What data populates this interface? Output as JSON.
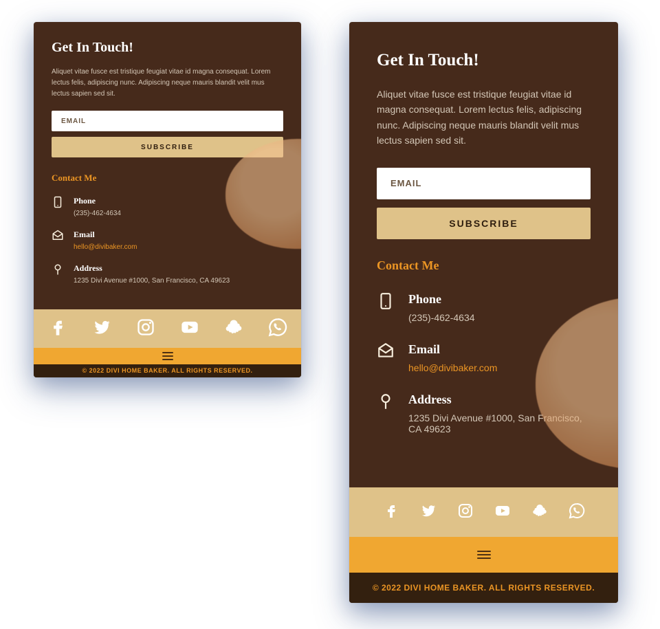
{
  "header": {
    "title": "Get In Touch!",
    "intro": "Aliquet vitae fusce est tristique feugiat vitae id magna consequat. Lorem lectus felis, adipiscing nunc. Adipiscing neque mauris blandit velit mus lectus sapien sed sit."
  },
  "email_placeholder": "EMAIL",
  "subscribe_label": "SUBSCRIBE",
  "contact_heading": "Contact Me",
  "phone": {
    "title": "Phone",
    "value": "(235)-462-4634"
  },
  "email": {
    "title": "Email",
    "value": "hello@divibaker.com"
  },
  "address": {
    "title": "Address",
    "value": "1235 Divi Avenue #1000, San Francisco, CA 49623"
  },
  "copyright": "© 2022 DIVI HOME BAKER. ALL RIGHTS RESERVED."
}
